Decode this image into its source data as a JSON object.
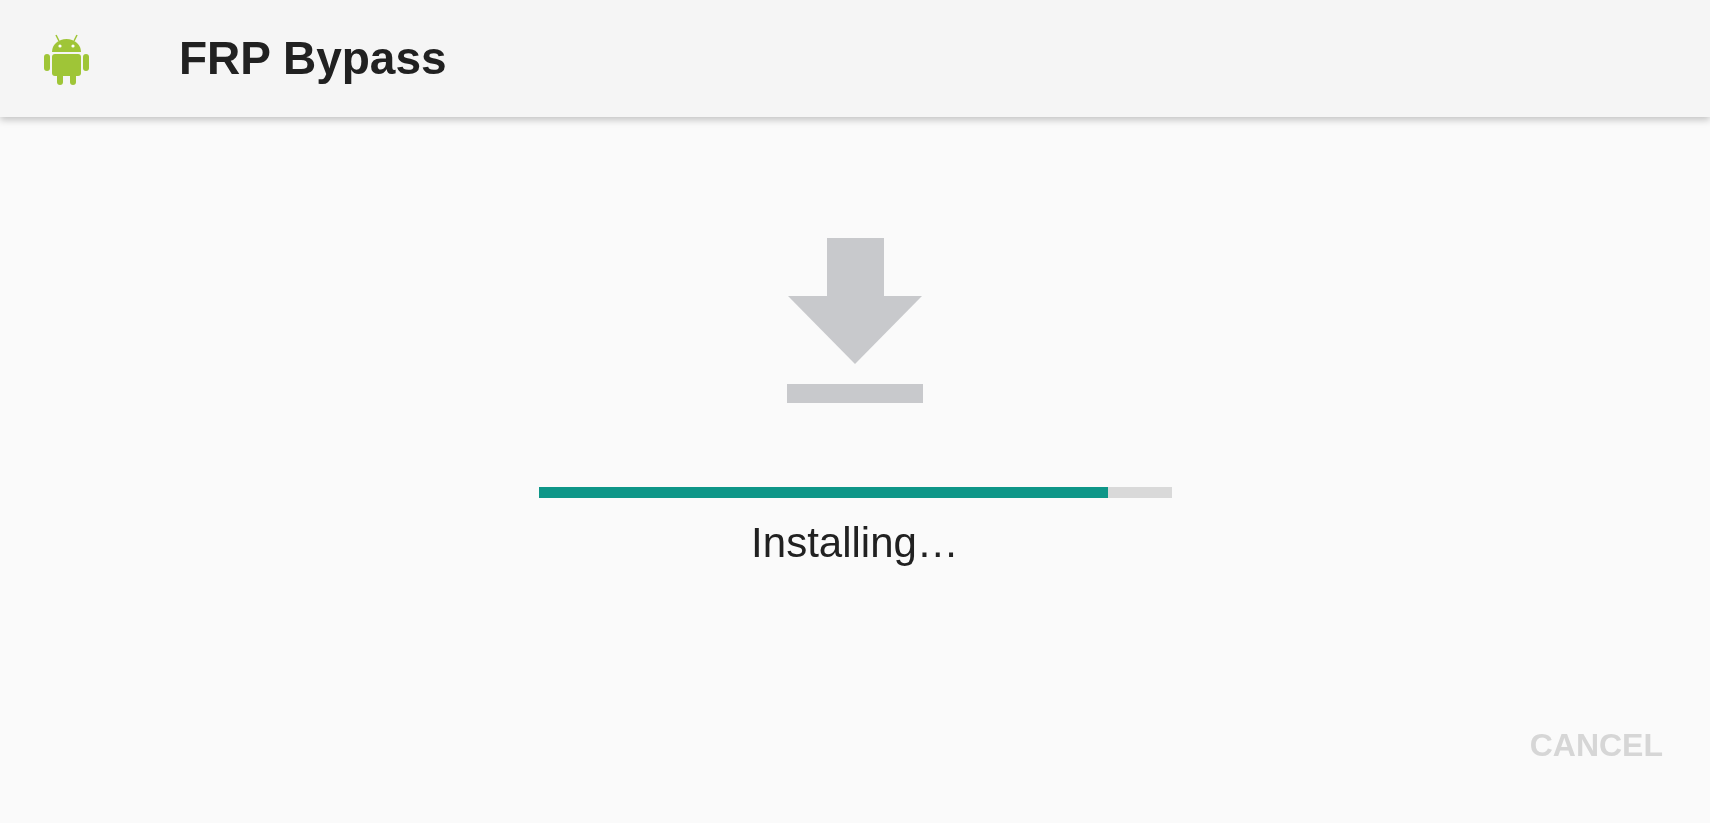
{
  "app_bar": {
    "title": "FRP Bypass"
  },
  "installer": {
    "progress": {
      "level": 0.9
    },
    "status": "Installing…"
  },
  "buttons": [
    {
      "label": "CANCEL",
      "disabled": true
    }
  ]
}
